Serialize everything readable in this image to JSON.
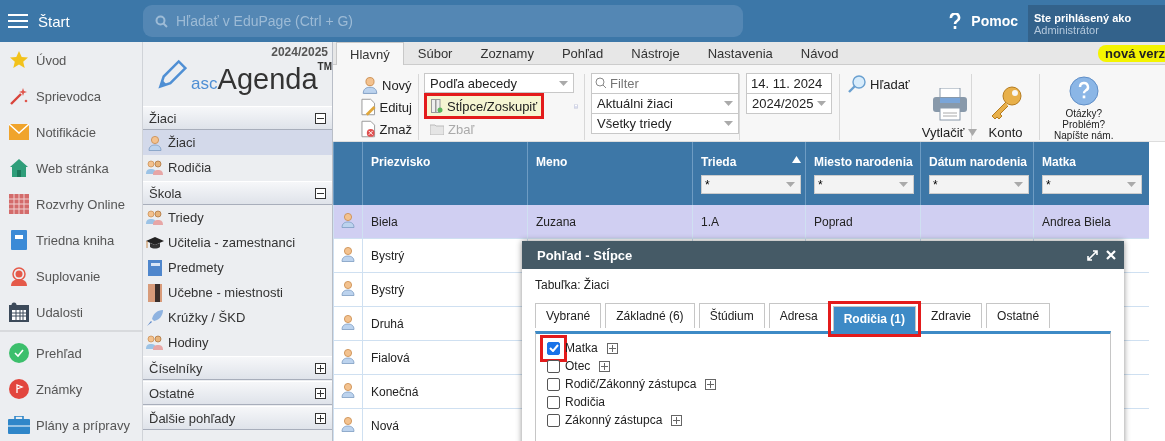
{
  "topbar": {
    "menu_label": "Štart",
    "search": {
      "placeholder": "Hľadať v EduPage (Ctrl + G)"
    },
    "help": "Pomoc",
    "user": {
      "caption": "Ste prihlásený ako",
      "name": "Administrátor"
    }
  },
  "nav": {
    "groups": [
      {
        "items": [
          {
            "label": "Úvod"
          },
          {
            "label": "Sprievodca"
          },
          {
            "label": "Notifikácie"
          },
          {
            "label": "Web stránka"
          },
          {
            "label": "Rozvrhy Online"
          },
          {
            "label": "Triedna kniha"
          },
          {
            "label": "Suplovanie"
          },
          {
            "label": "Udalosti"
          }
        ]
      },
      {
        "items": [
          {
            "label": "Prehľad"
          },
          {
            "label": "Známky"
          },
          {
            "label": "Plány a prípravy"
          }
        ]
      }
    ]
  },
  "module": {
    "year": "2024/2025",
    "logo": {
      "prefix": "asc",
      "name": "Agenda",
      "mark": "TM"
    },
    "sections": [
      {
        "title": "Žiaci",
        "expanded": true,
        "items": [
          {
            "label": "Žiaci",
            "selected": true
          },
          {
            "label": "Rodičia",
            "selected": false
          }
        ]
      },
      {
        "title": "Škola",
        "expanded": true,
        "items": [
          {
            "label": "Triedy",
            "selected": false
          },
          {
            "label": "Učitelia - zamestnanci",
            "selected": false
          },
          {
            "label": "Predmety",
            "selected": false
          },
          {
            "label": "Učebne - miestnosti",
            "selected": false
          },
          {
            "label": "Krúžky / ŠKD",
            "selected": false
          },
          {
            "label": "Hodiny",
            "selected": false
          }
        ]
      },
      {
        "title": "Číselníky",
        "expanded": false
      },
      {
        "title": "Ostatné",
        "expanded": false
      },
      {
        "title": "Ďalšie pohľady",
        "expanded": false
      }
    ]
  },
  "ribbon": {
    "tabs": [
      {
        "label": "Hlavný",
        "selected": true
      },
      {
        "label": "Súbor",
        "selected": false
      },
      {
        "label": "Zoznamy",
        "selected": false
      },
      {
        "label": "Pohľad",
        "selected": false
      },
      {
        "label": "Nástroje",
        "selected": false
      },
      {
        "label": "Nastavenia",
        "selected": false
      },
      {
        "label": "Návod",
        "selected": false
      }
    ],
    "badge": "nová verz",
    "actions": [
      {
        "label": "Nový"
      },
      {
        "label": "Edituj"
      },
      {
        "label": "Zmaž"
      }
    ],
    "sort": "Podľa abecedy",
    "columns_button": {
      "label": "Stĺpce/Zoskupiť",
      "highlighted": true
    },
    "collapse": {
      "label": "Zbaľ",
      "disabled": true
    },
    "filter": {
      "placeholder": "Filter"
    },
    "student_filter": "Aktuálni žiaci",
    "class_filter": "Všetky triedy",
    "date": "14. 11. 2024",
    "year": "2024/2025",
    "search": "Hľadať",
    "print": "Vytlačiť",
    "account": "Konto",
    "feedback": [
      "Otázky?",
      "Problém?",
      "Napíšte nám."
    ]
  },
  "table": {
    "columns": [
      {
        "label": "Priezvisko",
        "sorted": false
      },
      {
        "label": "Meno",
        "sorted": false
      },
      {
        "label": "Trieda",
        "sorted": true,
        "filter": "*"
      },
      {
        "label": "Miesto narodenia",
        "sorted": false,
        "filter": "*"
      },
      {
        "label": "Dátum narodenia",
        "sorted": false,
        "filter": "*"
      },
      {
        "label": "Matka",
        "sorted": false,
        "filter": "*"
      }
    ],
    "rows": [
      {
        "selected": true,
        "cells": [
          "Biela",
          "Zuzana",
          "1.A",
          "Poprad",
          null,
          "Andrea Biela"
        ]
      },
      {
        "selected": false,
        "cells": [
          "Bystrý"
        ]
      },
      {
        "selected": false,
        "cells": [
          "Bystrý"
        ]
      },
      {
        "selected": false,
        "cells": [
          "Druhá"
        ]
      },
      {
        "selected": false,
        "cells": [
          "Fialová"
        ]
      },
      {
        "selected": false,
        "cells": [
          "Konečná"
        ]
      },
      {
        "selected": false,
        "cells": [
          "Nová"
        ]
      }
    ]
  },
  "dialog": {
    "title": "Pohľad - Stĺpce",
    "table_label": "Tabuľka: Žiaci",
    "tabs": [
      {
        "label": "Vybrané",
        "selected": false,
        "highlighted": false
      },
      {
        "label": "Základné (6)",
        "selected": false,
        "highlighted": false
      },
      {
        "label": "Štúdium",
        "selected": false,
        "highlighted": false
      },
      {
        "label": "Adresa",
        "selected": false,
        "highlighted": false
      },
      {
        "label": "Rodičia (1)",
        "selected": true,
        "highlighted": true
      },
      {
        "label": "Zdravie",
        "selected": false,
        "highlighted": false
      },
      {
        "label": "Ostatné",
        "selected": false,
        "highlighted": false
      }
    ],
    "options": [
      {
        "label": "Matka",
        "checked": true,
        "expandable": true,
        "highlighted": true
      },
      {
        "label": "Otec",
        "checked": false,
        "expandable": true,
        "highlighted": false
      },
      {
        "label": "Rodič/Zákonný zástupca",
        "checked": false,
        "expandable": true,
        "highlighted": false
      },
      {
        "label": "Rodičia",
        "checked": false,
        "expandable": false,
        "highlighted": false
      },
      {
        "label": "Zákonný zástupca",
        "checked": false,
        "expandable": true,
        "highlighted": false
      }
    ]
  }
}
